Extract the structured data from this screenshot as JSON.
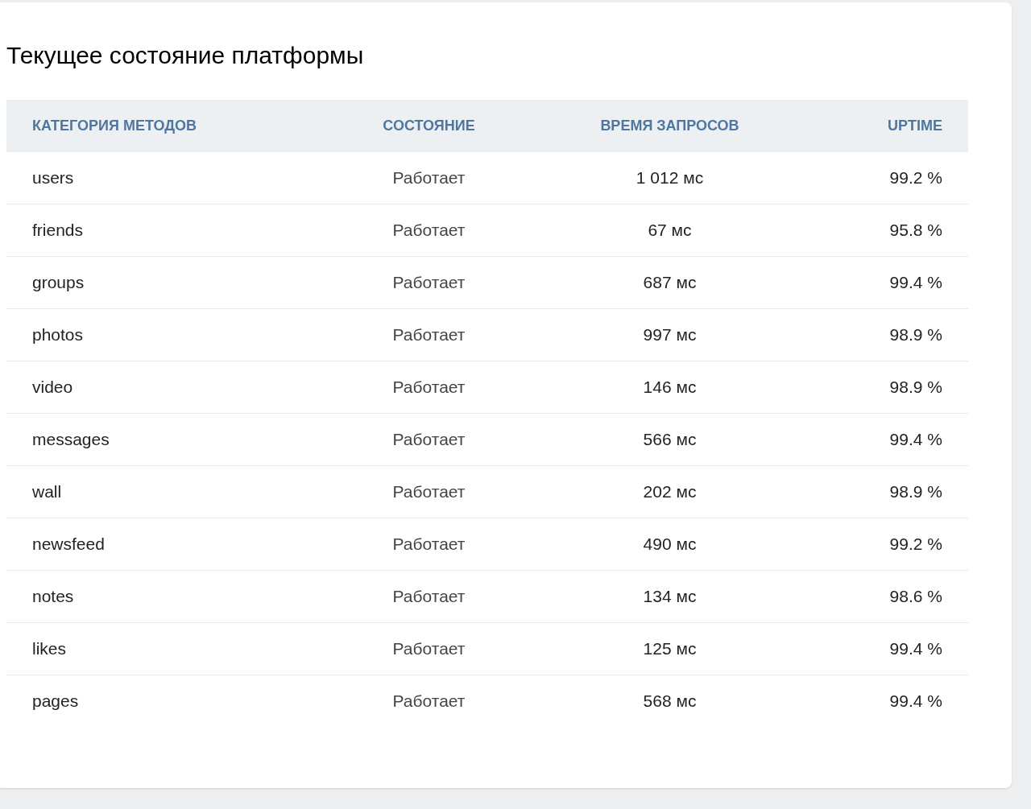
{
  "title": "Текущее состояние платформы",
  "table": {
    "columns": [
      "КАТЕГОРИЯ МЕТОДОВ",
      "СОСТОЯНИЕ",
      "ВРЕМЯ ЗАПРОСОВ",
      "UPTIME"
    ],
    "rows": [
      [
        "users",
        "Работает",
        "1 012 мс",
        "99.2 %"
      ],
      [
        "friends",
        "Работает",
        "67 мс",
        "95.8 %"
      ],
      [
        "groups",
        "Работает",
        "687 мс",
        "99.4 %"
      ],
      [
        "photos",
        "Работает",
        "997 мс",
        "98.9 %"
      ],
      [
        "video",
        "Работает",
        "146 мс",
        "98.9 %"
      ],
      [
        "messages",
        "Работает",
        "566 мс",
        "99.4 %"
      ],
      [
        "wall",
        "Работает",
        "202 мс",
        "98.9 %"
      ],
      [
        "newsfeed",
        "Работает",
        "490 мс",
        "99.2 %"
      ],
      [
        "notes",
        "Работает",
        "134 мс",
        "98.6 %"
      ],
      [
        "likes",
        "Работает",
        "125 мс",
        "99.4 %"
      ],
      [
        "pages",
        "Работает",
        "568 мс",
        "99.4 %"
      ]
    ]
  }
}
